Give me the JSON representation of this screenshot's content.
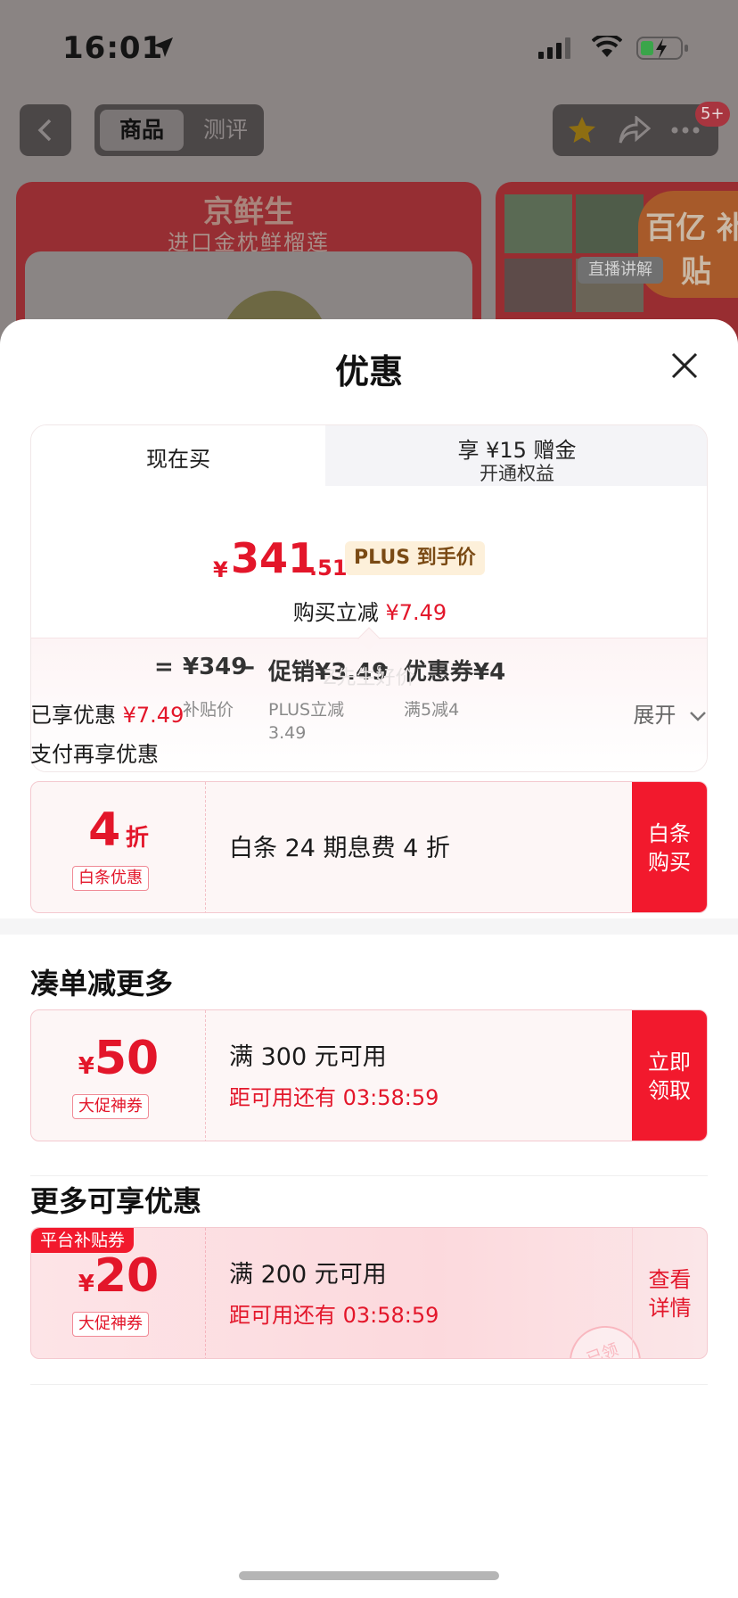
{
  "status_bar": {
    "time": "16:01"
  },
  "nav": {
    "tab_active": "商品",
    "tab_inactive": "测评",
    "badge": "5+"
  },
  "background": {
    "promo_title": "京鲜生",
    "promo_subtitle": "进口金枕鲜榴莲",
    "side_logo": "百亿\n补贴",
    "live_tag": "直播讲解"
  },
  "sheet": {
    "title": "优惠",
    "tabs": {
      "now": "现在买",
      "plus_main": "享 ¥15 赠金",
      "plus_sub": "开通权益"
    },
    "price": {
      "yen": "¥",
      "integer": "341",
      "decimal": ".51",
      "plus_tag": "PLUS 到手价"
    },
    "reduce": {
      "label": "购买立减 ",
      "amount": "¥7.49"
    },
    "calc": {
      "eq": "=",
      "base": "¥349",
      "base_sub": "补贴价",
      "minus1": "–",
      "promo": "促销¥3.49",
      "promo_sub": "PLUS立减\n3.49",
      "minus2": "–",
      "coupon": "优惠券¥4",
      "coupon_sub": "满5减4"
    },
    "watermark": "Z先生好价",
    "enjoyed": {
      "label": "已享优惠 ",
      "amount": "¥7.49",
      "expand": "展开"
    },
    "pay_more": "支付再享优惠",
    "baitiao": {
      "big": "4",
      "unit": "折",
      "tag": "白条优惠",
      "text": "白条 24 期息费 4 折",
      "button": "白条\n购买"
    },
    "section1_title": "凑单减更多",
    "coupon50": {
      "yen": "¥",
      "big": "50",
      "tag": "大促神券",
      "text": "满 300 元可用",
      "countdown": "距可用还有 03:58:59",
      "button": "立即\n领取"
    },
    "section2_title": "更多可享优惠",
    "coupon20": {
      "corner": "平台补贴券",
      "yen": "¥",
      "big": "20",
      "tag": "大促神券",
      "text": "满 200 元可用",
      "countdown": "距可用还有 03:58:59",
      "button": "查看\n详情",
      "stamp": "已领"
    }
  },
  "colors": {
    "accent_red": "#e3162a",
    "button_red": "#f2192d",
    "plus_gold": "#7a4a14"
  }
}
